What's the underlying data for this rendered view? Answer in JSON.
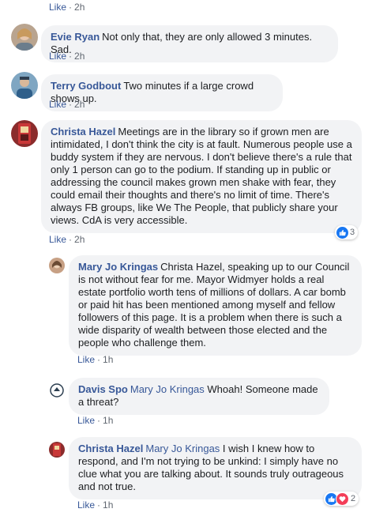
{
  "common": {
    "like_label": "Like",
    "separator": "·"
  },
  "top_meta": {
    "time": "2h"
  },
  "comments": [
    {
      "author": "Evie Ryan",
      "text": "Not only that, they are only allowed 3 minutes. Sad.",
      "time": "2h"
    },
    {
      "author": "Terry Godbout",
      "text": "Two minutes if a large crowd shows up.",
      "time": "2h"
    },
    {
      "author": "Christa Hazel",
      "text": "Meetings are in the library so if grown men are intimidated, I don't think the city is at fault. Numerous people use a buddy system if they are nervous. I don't believe there's a rule that only 1 person can go to the podium. If standing up in public or addressing the council makes grown men shake with fear, they could email their thoughts and there's no limit of time. There's always FB groups, like We The People, that publicly share your views. CdA is very accessible.",
      "time": "2h",
      "reaction_count": "3"
    }
  ],
  "replies": [
    {
      "author": "Mary Jo Kringas",
      "text": "Christa Hazel, speaking up to our Council is not without fear for me. Mayor Widmyer holds a real estate portfolio worth tens of millions of dollars. A car bomb or paid hit has been mentioned among myself and fellow followers of this page. It is a problem when there is such a wide disparity of wealth between those elected and the people who challenge them.",
      "time": "1h"
    },
    {
      "author": "Davis Spo",
      "mention": "Mary Jo Kringas",
      "text": "Whoah! Someone made a threat?",
      "time": "1h"
    },
    {
      "author": "Christa Hazel",
      "mention": "Mary Jo Kringas",
      "text": "I wish I knew how to respond, and I'm not trying to be unkind: I simply have no clue what you are talking about. It sounds truly outrageous and not true.",
      "time": "1h",
      "reaction_count": "2"
    }
  ],
  "colors": {
    "link": "#385898",
    "bubble": "#f2f3f5",
    "like_blue": "#1877f2",
    "love_red": "#f33e58"
  }
}
